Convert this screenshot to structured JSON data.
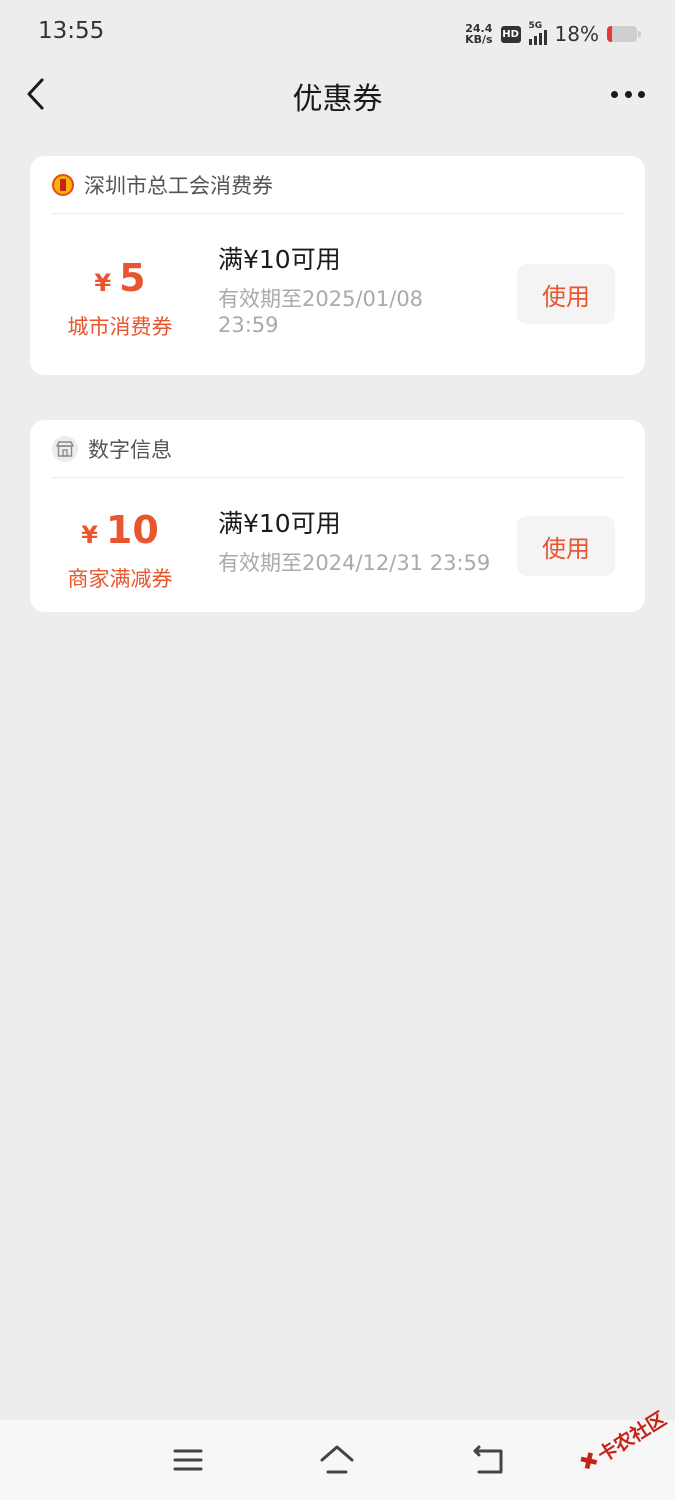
{
  "status_bar": {
    "time": "13:55",
    "speed_value": "24.4",
    "speed_unit": "KB/s",
    "hd_badge": "HD",
    "network": "5G",
    "battery_percent": "18%",
    "battery_level": 0.18,
    "battery_color": "#E53935"
  },
  "nav": {
    "title": "优惠券",
    "back_icon": "chevron-left-icon",
    "more_icon": "more-dots-icon"
  },
  "coupons": [
    {
      "merchant_name": "深圳市总工会消费券",
      "merchant_icon": "union-logo-icon",
      "currency_symbol": "¥",
      "amount": "5",
      "coupon_type": "城市消费券",
      "condition": "满¥10可用",
      "validity_line1": "有效期至2025/01/08",
      "validity_line2": "23:59",
      "use_label": "使用"
    },
    {
      "merchant_name": "数字信息",
      "merchant_icon": "store-icon",
      "currency_symbol": "¥",
      "amount": "10",
      "coupon_type": "商家满减券",
      "condition": "满¥10可用",
      "validity_line1": "有效期至2024/12/31 23:59",
      "use_label": "使用"
    }
  ],
  "bottom_nav": {
    "menu_icon": "menu-icon",
    "home_icon": "home-icon",
    "back_icon": "back-arrow-icon"
  },
  "watermark": {
    "text": "卡农社区"
  },
  "colors": {
    "accent": "#E8552F",
    "page_background": "#EDEDED",
    "card_background": "#FFFFFF"
  }
}
